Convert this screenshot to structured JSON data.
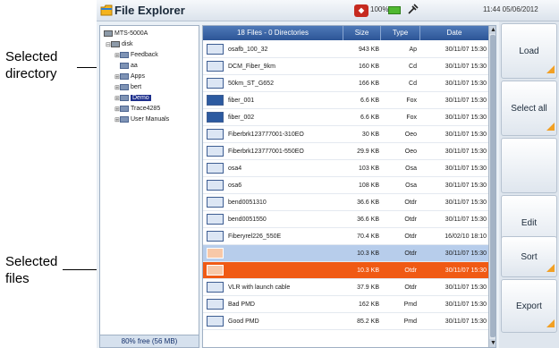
{
  "annotations": {
    "selected_directory": [
      "Selected",
      "directory"
    ],
    "selected_files": [
      "Selected",
      "files"
    ]
  },
  "titlebar": {
    "title": "File Explorer",
    "battery": "100%",
    "clock": "11:44  05/06/2012",
    "icons": [
      "file-explorer-icon",
      "logo-icon",
      "battery-icon",
      "power-icon"
    ]
  },
  "tree": {
    "items": [
      {
        "label": "MTS-5000A",
        "icon": "drive-icon",
        "selected": false
      },
      {
        "label": "disk",
        "icon": "drive-icon",
        "selected": false
      },
      {
        "label": "Feedback",
        "icon": "folder-icon",
        "selected": false
      },
      {
        "label": "aa",
        "icon": "folder-icon",
        "selected": false
      },
      {
        "label": "Apps",
        "icon": "folder-icon",
        "selected": false
      },
      {
        "label": "bert",
        "icon": "folder-icon",
        "selected": false
      },
      {
        "label": "Demo",
        "icon": "folder-icon",
        "selected": true
      },
      {
        "label": "Trace4285",
        "icon": "folder-icon",
        "selected": false
      },
      {
        "label": "User Manuals",
        "icon": "folder-icon",
        "selected": false
      }
    ],
    "free_space": "80% free (56 MB)"
  },
  "file_list": {
    "header": {
      "count": "18 Files - 0 Directories",
      "size": "Size",
      "type": "Type",
      "date": "Date"
    },
    "rows": [
      {
        "name": "osafb_100_32",
        "size": "943 KB",
        "type": "Ap",
        "date": "30/11/07 15:30",
        "sel": ""
      },
      {
        "name": "DCM_Fiber_9km",
        "size": "160 KB",
        "type": "Cd",
        "date": "30/11/07 15:30",
        "sel": ""
      },
      {
        "name": "50km_ST_G652",
        "size": "166 KB",
        "type": "Cd",
        "date": "30/11/07 15:30",
        "sel": ""
      },
      {
        "name": "fiber_001",
        "size": "6.6 KB",
        "type": "Fox",
        "date": "30/11/07 15:30",
        "sel": ""
      },
      {
        "name": "fiber_002",
        "size": "6.6 KB",
        "type": "Fox",
        "date": "30/11/07 15:30",
        "sel": ""
      },
      {
        "name": "Fiberbrk123777001-310EO",
        "size": "30 KB",
        "type": "Oeo",
        "date": "30/11/07 15:30",
        "sel": ""
      },
      {
        "name": "Fiberbrk123777001-550EO",
        "size": "29.9 KB",
        "type": "Oeo",
        "date": "30/11/07 15:30",
        "sel": ""
      },
      {
        "name": "osa4",
        "size": "103 KB",
        "type": "Osa",
        "date": "30/11/07 15:30",
        "sel": ""
      },
      {
        "name": "osa6",
        "size": "108 KB",
        "type": "Osa",
        "date": "30/11/07 15:30",
        "sel": ""
      },
      {
        "name": "bend0051310",
        "size": "36.6 KB",
        "type": "Otdr",
        "date": "30/11/07 15:30",
        "sel": ""
      },
      {
        "name": "bend0051550",
        "size": "36.6 KB",
        "type": "Otdr",
        "date": "30/11/07 15:30",
        "sel": ""
      },
      {
        "name": "Fiberyrel226_550E",
        "size": "70.4 KB",
        "type": "Otdr",
        "date": "16/02/10 18:10",
        "sel": ""
      },
      {
        "name": "",
        "size": "10.3 KB",
        "type": "Otdr",
        "date": "30/11/07 15:30",
        "sel": "blue"
      },
      {
        "name": "",
        "size": "10.3 KB",
        "type": "Otdr",
        "date": "30/11/07 15:30",
        "sel": "orange"
      },
      {
        "name": "VLR with launch cable",
        "size": "37.9 KB",
        "type": "Otdr",
        "date": "30/11/07 15:30",
        "sel": ""
      },
      {
        "name": "Bad PMD",
        "size": "162 KB",
        "type": "Pmd",
        "date": "30/11/07 15:30",
        "sel": ""
      },
      {
        "name": "Good PMD",
        "size": "85.2 KB",
        "type": "Pmd",
        "date": "30/11/07 15:30",
        "sel": ""
      }
    ]
  },
  "softkeys": [
    "Load",
    "Select all",
    "",
    "Edit",
    "Sort",
    "Export"
  ],
  "colors": {
    "header_blue": "#2d5596",
    "selection_blue": "#b7cdeb",
    "selection_orange": "#f05a14",
    "tree_selected": "#1d2f8c",
    "softkey_corner": "#f2a024"
  }
}
